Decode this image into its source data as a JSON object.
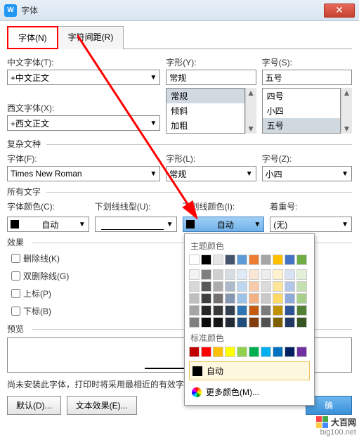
{
  "window": {
    "title": "字体",
    "icon_letter": "W"
  },
  "tabs": {
    "font": "字体(N)",
    "spacing": "字符间距(R)"
  },
  "labels": {
    "cn_font": "中文字体(T):",
    "style": "字形(Y):",
    "size": "字号(S):",
    "west_font": "西文字体(X):",
    "complex": "复杂文种",
    "font_f": "字体(F):",
    "style_l": "字形(L):",
    "size_z": "字号(Z):",
    "all_text": "所有文字",
    "font_color": "字体颜色(C):",
    "underline_style": "下划线线型(U):",
    "underline_color": "下划线颜色(I):",
    "emphasis": "着重号:",
    "effects": "效果",
    "preview": "预览"
  },
  "values": {
    "cn_font": "+中文正文",
    "style": "常规",
    "size": "五号",
    "west_font": "+西文正文",
    "font_f": "Times New Roman",
    "style_l": "常规",
    "size_z": "小四",
    "font_color": "自动",
    "underline_style": "",
    "underline_color": "自动",
    "emphasis": "(无)"
  },
  "style_list": [
    "常规",
    "倾斜",
    "加粗"
  ],
  "size_list": [
    "四号",
    "小四",
    "五号"
  ],
  "checks": {
    "strike": "删除线(K)",
    "dstrike": "双删除线(G)",
    "sup": "上标(P)",
    "sub": "下标(B)"
  },
  "note": "尚未安装此字体，打印时将采用最相近的有效字体。",
  "buttons": {
    "default": "默认(D)...",
    "text_effect": "文本效果(E)...",
    "ok": "确"
  },
  "popup": {
    "theme": "主题颜色",
    "standard": "标准颜色",
    "auto": "自动",
    "more": "更多颜色(M)...",
    "theme_colors_row1": [
      "#ffffff",
      "#000000",
      "#e7e6e6",
      "#44546a",
      "#5b9bd5",
      "#ed7d31",
      "#a5a5a5",
      "#ffc000",
      "#4472c4",
      "#70ad47"
    ],
    "theme_shades": [
      [
        "#f2f2f2",
        "#7f7f7f",
        "#d0cece",
        "#d6dce4",
        "#deebf6",
        "#fbe5d5",
        "#ededed",
        "#fff2cc",
        "#d9e2f3",
        "#e2efd9"
      ],
      [
        "#d8d8d8",
        "#595959",
        "#aeabab",
        "#adb9ca",
        "#bdd7ee",
        "#f7cbac",
        "#dbdbdb",
        "#fee599",
        "#b4c6e7",
        "#c5e0b3"
      ],
      [
        "#bfbfbf",
        "#3f3f3f",
        "#757070",
        "#8496b0",
        "#9cc3e5",
        "#f4b183",
        "#c9c9c9",
        "#ffd965",
        "#8eaadb",
        "#a8d08d"
      ],
      [
        "#a5a5a5",
        "#262626",
        "#3a3838",
        "#323f4f",
        "#2e75b5",
        "#c55a11",
        "#7b7b7b",
        "#bf9000",
        "#2f5496",
        "#538135"
      ],
      [
        "#7f7f7f",
        "#0c0c0c",
        "#171616",
        "#222a35",
        "#1e4e79",
        "#833c0b",
        "#525252",
        "#7f6000",
        "#1f3864",
        "#375623"
      ]
    ],
    "standard_colors": [
      "#c00000",
      "#ff0000",
      "#ffc000",
      "#ffff00",
      "#92d050",
      "#00b050",
      "#00b0f0",
      "#0070c0",
      "#002060",
      "#7030a0"
    ]
  },
  "watermark": {
    "brand": "大百网",
    "url": "big100.net"
  }
}
